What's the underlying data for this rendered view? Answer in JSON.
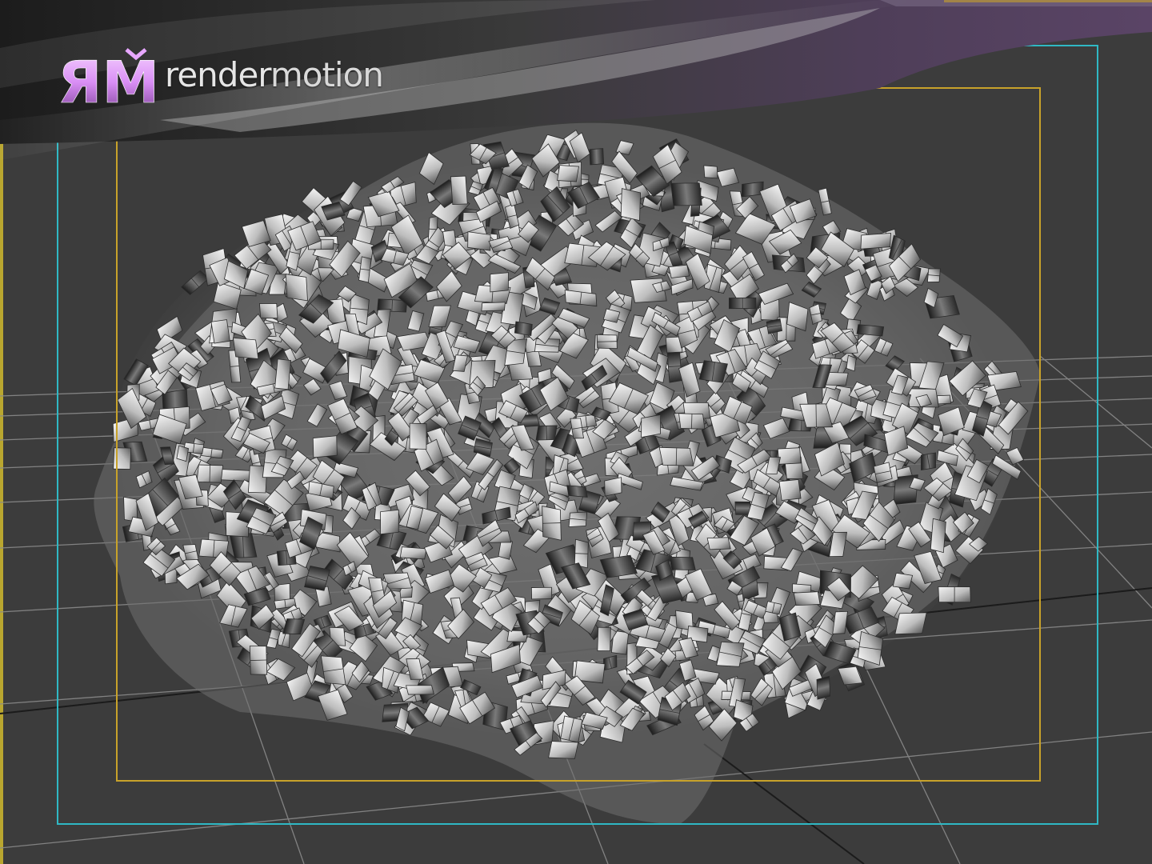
{
  "brand": {
    "mark": "ЯM",
    "name_part1": "render",
    "name_part2": "motion"
  },
  "colors": {
    "viewport_background": "#3c3c3c",
    "safe_frame_outer": "#2fb8c4",
    "safe_frame_inner": "#c8a22a",
    "frame_left_edge": "#b9a62f",
    "grid_lines": "#8c8c8c",
    "logo_mark_pink": "#e7a7ff",
    "banner_purple": "#4a3a52"
  },
  "icons": {
    "logo_mark": "rendermotion-logo-mark"
  }
}
